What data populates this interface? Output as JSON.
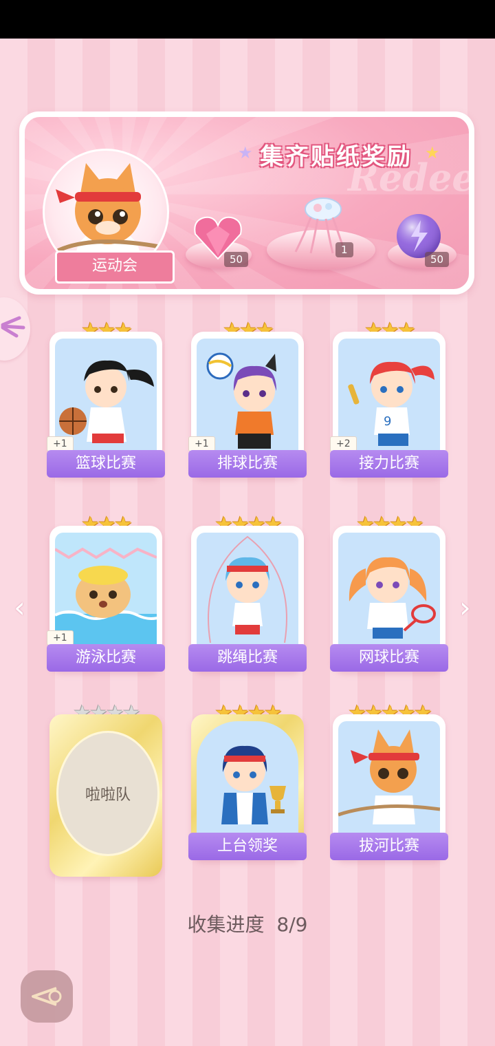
{
  "banner": {
    "title": "集齐贴纸奖励",
    "watermark": "Redeem",
    "event_label": "运动会",
    "rewards": [
      {
        "icon": "pink-heart-gem-icon",
        "count": "50"
      },
      {
        "icon": "jellyfish-ornament-icon",
        "count": "1"
      },
      {
        "icon": "purple-energy-orb-icon",
        "count": "50"
      }
    ]
  },
  "stickers": [
    {
      "label": "篮球比赛",
      "stars": 3,
      "count": "+1",
      "icon": "basketball-girl-icon",
      "collected": true
    },
    {
      "label": "排球比赛",
      "stars": 3,
      "count": "+1",
      "icon": "volleyball-girl-icon",
      "collected": true
    },
    {
      "label": "接力比赛",
      "stars": 3,
      "count": "+2",
      "icon": "relay-girl-icon",
      "collected": true
    },
    {
      "label": "游泳比赛",
      "stars": 3,
      "count": "+1",
      "icon": "swimming-dog-icon",
      "collected": true
    },
    {
      "label": "跳绳比赛",
      "stars": 4,
      "count": "",
      "icon": "jump-rope-girl-icon",
      "collected": true
    },
    {
      "label": "网球比赛",
      "stars": 4,
      "count": "",
      "icon": "tennis-girl-icon",
      "collected": true
    },
    {
      "label": "啦啦队",
      "stars": 4,
      "count": "",
      "icon": "locked-sticker-icon",
      "collected": false
    },
    {
      "label": "上台领奖",
      "stars": 4,
      "count": "",
      "icon": "trophy-girl-icon",
      "collected": true
    },
    {
      "label": "拔河比赛",
      "stars": 5,
      "count": "",
      "icon": "tug-of-war-cat-icon",
      "collected": true
    }
  ],
  "progress": {
    "label": "收集进度",
    "value": "8/9"
  }
}
